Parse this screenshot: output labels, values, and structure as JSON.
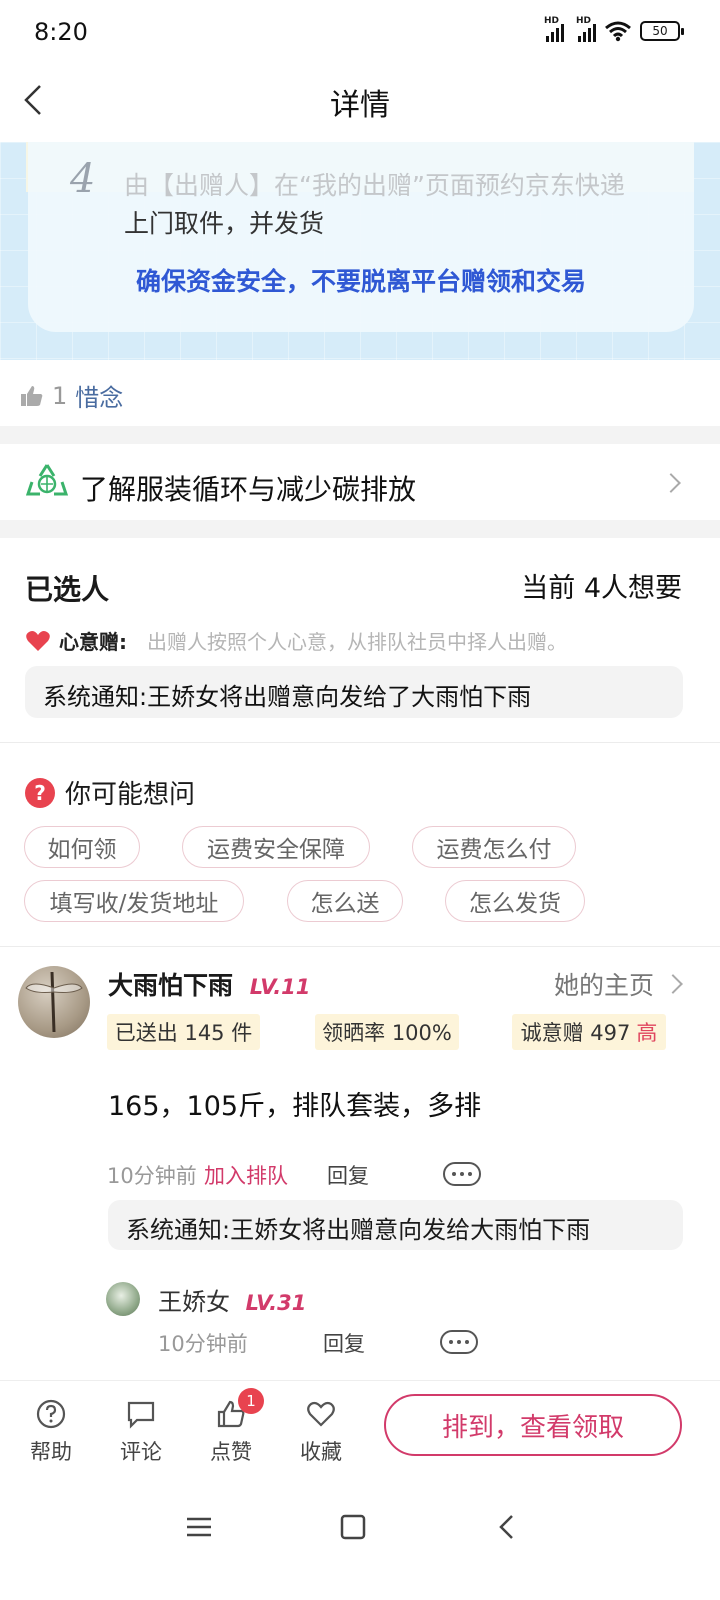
{
  "status_bar": {
    "time": "8:20",
    "battery": "50"
  },
  "header": {
    "title": "详情"
  },
  "banner": {
    "step_number": "4",
    "step_line1": "由【出赠人】在“我的出赠”页面预约京东快递",
    "step_line2": "上门取件，并发货",
    "safety_text": "确保资金安全，不要脱离平台赠领和交易"
  },
  "likes": {
    "count": "1",
    "name": "惜念"
  },
  "eco": {
    "label": "了解服装循环与减少碳排放"
  },
  "selected": {
    "title": "已选人",
    "count_text": "当前 4人想要",
    "heart_label": "心意赠:",
    "heart_desc": "出赠人按照个人心意，从排队社员中择人出赠。",
    "notice": "系统通知:王娇女将出赠意向发给了大雨怕下雨"
  },
  "faq": {
    "title": "你可能想问",
    "chips": [
      "如何领",
      "运费安全保障",
      "运费怎么付",
      "填写收/发货地址",
      "怎么送",
      "怎么发货"
    ]
  },
  "comment": {
    "user": "大雨怕下雨",
    "level": "LV.11",
    "homepage": "她的主页",
    "stats": {
      "sent": "已送出 145 件",
      "rate": "领晒率 100%",
      "sincerity": "诚意赠 497",
      "sincerity_tag": "高"
    },
    "text": "165，105斤，排队套装，多排",
    "time": "10分钟前",
    "action": "加入排队",
    "reply_label": "回复",
    "system_reply": "系统通知:王娇女将出赠意向发给大雨怕下雨",
    "reply_user": "王娇女",
    "reply_level": "LV.31",
    "reply_time": "10分钟前",
    "reply_reply_label": "回复"
  },
  "bottom_bar": {
    "help": "帮助",
    "comment": "评论",
    "like": "点赞",
    "like_badge": "1",
    "favorite": "收藏",
    "cta": "排到，查看领取"
  },
  "colors": {
    "accent": "#d23a6a",
    "link_blue": "#2f58d4",
    "badge_red": "#e8434f"
  }
}
